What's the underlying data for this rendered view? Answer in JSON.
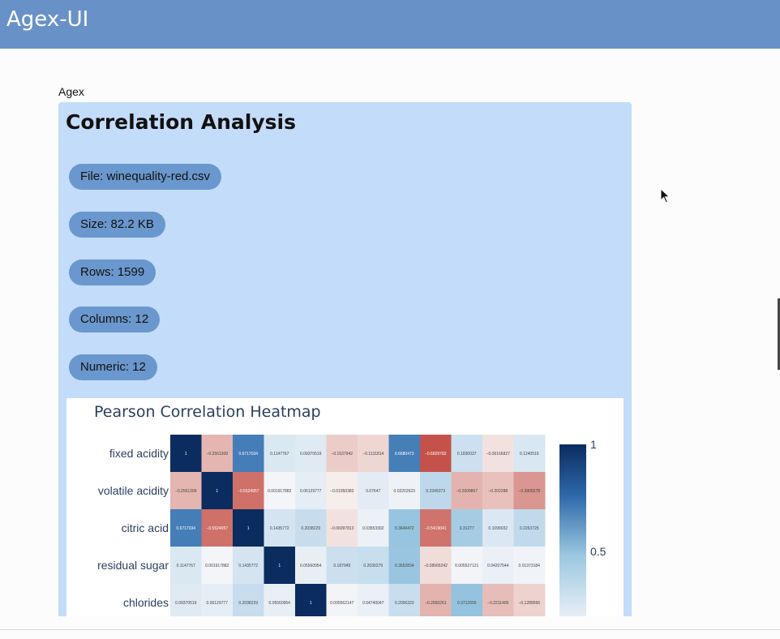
{
  "app": {
    "title": "Agex-UI"
  },
  "card": {
    "label": "Agex",
    "title": "Correlation Analysis",
    "pills": [
      {
        "text": "File: winequality-red.csv"
      },
      {
        "text": "Size: 82.2 KB"
      },
      {
        "text": "Rows: 1599"
      },
      {
        "text": "Columns: 12"
      },
      {
        "text": "Numeric: 12"
      }
    ]
  },
  "colors": {
    "header": "#6892c7",
    "card": "#c3dcfa",
    "pill": "#6a97cd"
  },
  "chart_data": {
    "type": "heatmap",
    "title": "Pearson Correlation Heatmap",
    "rows": [
      "fixed acidity",
      "volatile acidity",
      "citric acid",
      "residual sugar",
      "chlorides"
    ],
    "matrix": [
      [
        "1",
        "−0.2561309",
        "0.6717034",
        "0.1147767",
        "0.09370519",
        "−0.1537942",
        "−0.1131814",
        "0.6680473",
        "−0.6829782",
        "0.1830037",
        "−0.06166827",
        "0.1240519"
      ],
      [
        "−0.2561309",
        "1",
        "−0.5524957",
        "0.001917882",
        "0.06129777",
        "−0.01050383",
        "0.07647",
        "0.02202623",
        "0.2349373",
        "−0.2609867",
        "−0.202288",
        "−0.3905578"
      ],
      [
        "0.6717034",
        "−0.5524957",
        "1",
        "0.1435772",
        "0.2038229",
        "−0.06097813",
        "0.03553302",
        "0.3649472",
        "−0.5419041",
        "0.31277",
        "0.1099032",
        "0.2263725"
      ],
      [
        "0.1147767",
        "0.001917882",
        "0.1435772",
        "1",
        "0.05560954",
        "0.187049",
        "0.2030279",
        "0.3552834",
        "−0.08565242",
        "0.005527121",
        "0.04207544",
        "0.01373184"
      ],
      [
        "0.09370519",
        "0.06129777",
        "0.2038229",
        "0.05560954",
        "1",
        "0.005562147",
        "0.04740047",
        "0.2006323",
        "−0.2650261",
        "0.3712605",
        "−0.2211405",
        "−0.1289066"
      ]
    ],
    "colorbar": {
      "ticks": [
        "1",
        "0.5"
      ]
    }
  }
}
